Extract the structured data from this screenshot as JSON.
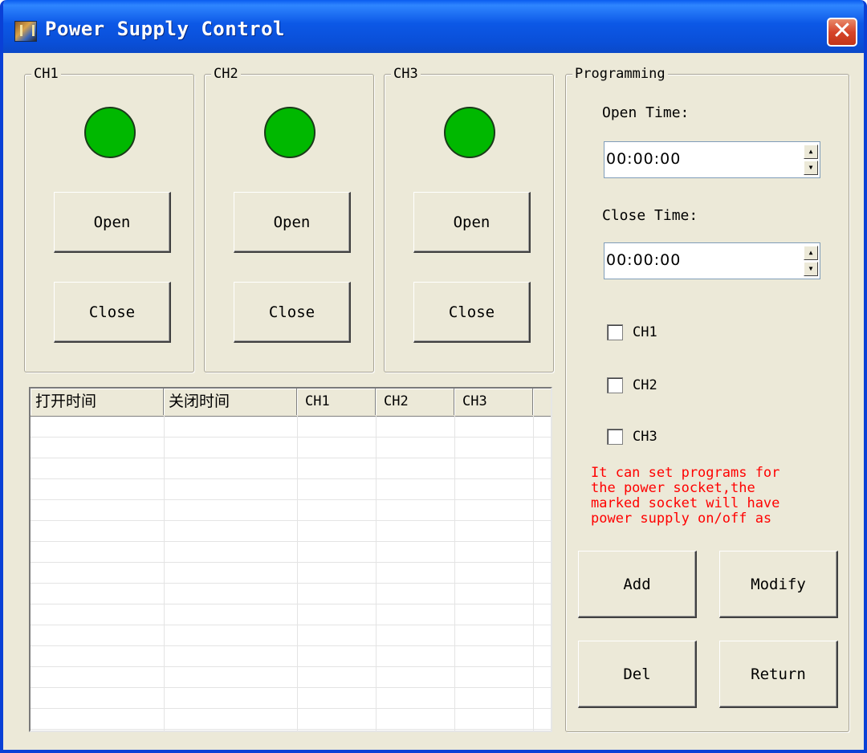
{
  "window": {
    "title": "Power Supply Control",
    "close_glyph": "✕"
  },
  "channels": [
    {
      "name": "CH1",
      "led_color": "#00b800",
      "open_label": "Open",
      "close_label": "Close"
    },
    {
      "name": "CH2",
      "led_color": "#00b800",
      "open_label": "Open",
      "close_label": "Close"
    },
    {
      "name": "CH3",
      "led_color": "#00b800",
      "open_label": "Open",
      "close_label": "Close"
    }
  ],
  "table": {
    "columns": [
      "打开时间",
      "关闭时间",
      "CH1",
      "CH2",
      "CH3"
    ],
    "rows": []
  },
  "programming": {
    "title": "Programming",
    "open_time_label": "Open Time:",
    "open_time_value": "00:00:00",
    "close_time_label": "Close Time:",
    "close_time_value": "00:00:00",
    "checkboxes": [
      {
        "label": "CH1",
        "checked": false
      },
      {
        "label": "CH2",
        "checked": false
      },
      {
        "label": "CH3",
        "checked": false
      }
    ],
    "note": "It can set programs for\nthe power socket,the\nmarked socket will have\npower supply on/off as",
    "note_color": "#ff0000",
    "buttons": {
      "add": "Add",
      "modify": "Modify",
      "del": "Del",
      "return": "Return"
    }
  }
}
